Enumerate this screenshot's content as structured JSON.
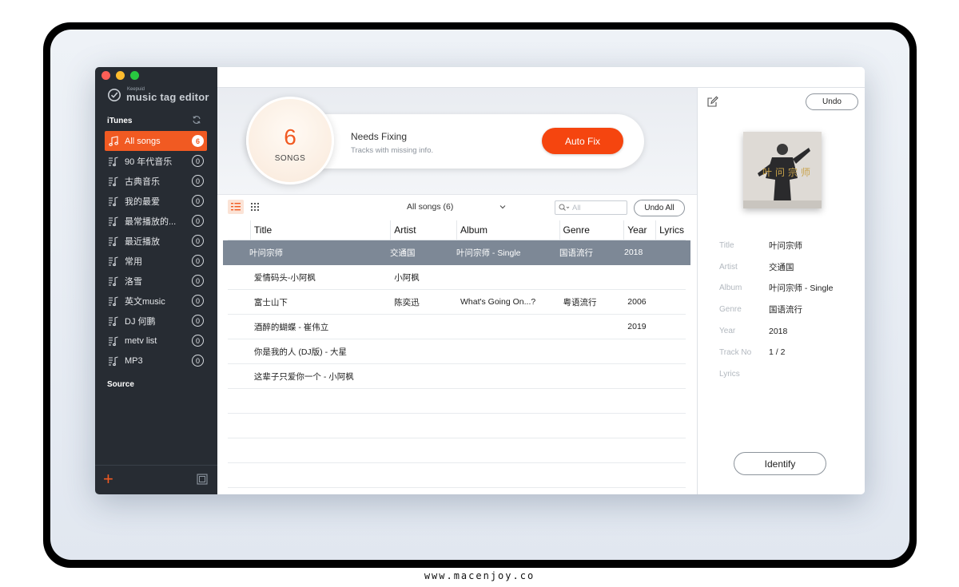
{
  "brand": {
    "small": "Keepuid",
    "name": "music tag editor"
  },
  "colors": {
    "accent": "#f15a22",
    "sidebar": "#272c33",
    "selected_row": "#7d8896"
  },
  "sidebar": {
    "itunes_header": "iTunes",
    "source_header": "Source",
    "playlists": [
      {
        "label": "All songs",
        "count": "6",
        "icon": "music-note-icon",
        "active": true
      },
      {
        "label": "90 年代音乐",
        "count": "0",
        "icon": "playlist-icon"
      },
      {
        "label": "古典音乐",
        "count": "0",
        "icon": "playlist-icon"
      },
      {
        "label": "我的最爱",
        "count": "0",
        "icon": "playlist-icon"
      },
      {
        "label": "最常播放的...",
        "count": "0",
        "icon": "playlist-icon"
      },
      {
        "label": "最近播放",
        "count": "0",
        "icon": "playlist-icon"
      },
      {
        "label": "常用",
        "count": "0",
        "icon": "playlist-icon"
      },
      {
        "label": "洛雪",
        "count": "0",
        "icon": "playlist-icon"
      },
      {
        "label": "英文music",
        "count": "0",
        "icon": "playlist-icon"
      },
      {
        "label": "DJ 何鹏",
        "count": "0",
        "icon": "playlist-icon"
      },
      {
        "label": "metv list",
        "count": "0",
        "icon": "playlist-icon"
      },
      {
        "label": "MP3",
        "count": "0",
        "icon": "playlist-icon"
      }
    ],
    "add_label": "+"
  },
  "banner": {
    "count": "6",
    "count_label": "SONGS",
    "title": "Needs Fixing",
    "subtitle": "Tracks with missing info.",
    "autofix_label": "Auto Fix"
  },
  "toolbar": {
    "filter_label": "All songs (6)",
    "search_placeholder": "All",
    "undo_all_label": "Undo All"
  },
  "table": {
    "columns": [
      "Title",
      "Artist",
      "Album",
      "Genre",
      "Year",
      "Lyrics"
    ],
    "rows": [
      {
        "title": "叶问宗师",
        "artist": "交通国",
        "album": "叶问宗师 - Single",
        "genre": "国语流行",
        "year": "2018",
        "lyrics": "",
        "selected": true
      },
      {
        "title": "爱情码头-小阿枫",
        "artist": "小阿枫",
        "album": "",
        "genre": "",
        "year": "",
        "lyrics": ""
      },
      {
        "title": "富士山下",
        "artist": "陈奕迅",
        "album": "What's Going On...?",
        "genre": "粤语流行",
        "year": "2006",
        "lyrics": ""
      },
      {
        "title": "酒醉的蝴蝶 - 崔伟立",
        "artist": "",
        "album": "",
        "genre": "",
        "year": "2019",
        "lyrics": ""
      },
      {
        "title": "你是我的人 (DJ版) - 大星",
        "artist": "",
        "album": "",
        "genre": "",
        "year": "",
        "lyrics": ""
      },
      {
        "title": "这辈子只爱你一个 - 小阿枫",
        "artist": "",
        "album": "",
        "genre": "",
        "year": "",
        "lyrics": ""
      }
    ]
  },
  "details": {
    "undo_label": "Undo",
    "cover_text": "叶问宗师",
    "fields": [
      {
        "key": "Title",
        "value": "叶问宗师"
      },
      {
        "key": "Artist",
        "value": "交通国"
      },
      {
        "key": "Album",
        "value": "叶问宗师 - Single"
      },
      {
        "key": "Genre",
        "value": "国语流行"
      },
      {
        "key": "Year",
        "value": "2018"
      },
      {
        "key": "Track No",
        "value": "1 / 2"
      },
      {
        "key": "Lyrics",
        "value": ""
      }
    ],
    "identify_label": "Identify"
  },
  "watermark": "www.macenjoy.co"
}
